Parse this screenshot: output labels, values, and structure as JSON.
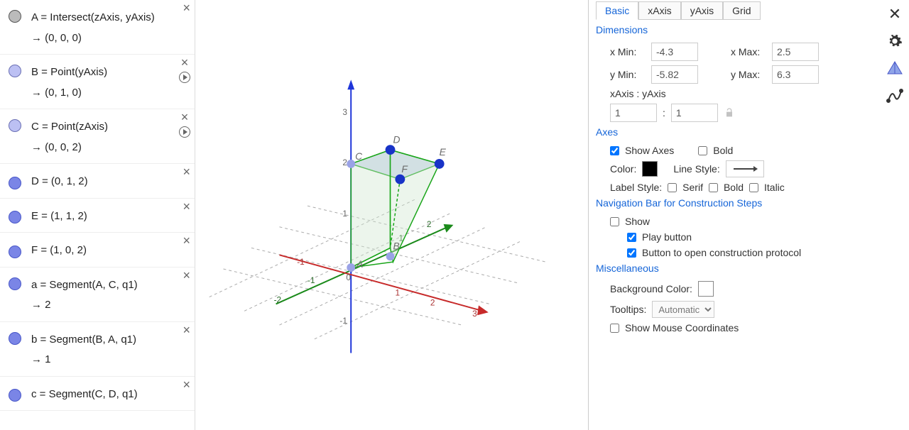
{
  "algebra": {
    "rows": [
      {
        "line1": "A = Intersect(zAxis, yAxis)",
        "line2": "→   (0, 0, 0)",
        "bullet": "gray",
        "close": true,
        "play": false
      },
      {
        "line1": "B = Point(yAxis)",
        "line2": "→   (0, 1, 0)",
        "bullet": "lav",
        "close": true,
        "play": true
      },
      {
        "line1": "C = Point(zAxis)",
        "line2": "→   (0, 0, 2)",
        "bullet": "lav",
        "close": true,
        "play": true
      },
      {
        "line1": "D = (0, 1, 2)",
        "line2": "",
        "bullet": "blue",
        "close": true,
        "play": false
      },
      {
        "line1": "E = (1, 1, 2)",
        "line2": "",
        "bullet": "blue",
        "close": true,
        "play": false
      },
      {
        "line1": "F = (1, 0, 2)",
        "line2": "",
        "bullet": "blue",
        "close": true,
        "play": false
      },
      {
        "line1": "a = Segment(A, C, q1)",
        "line2": "→   2",
        "bullet": "blue",
        "close": true,
        "play": false
      },
      {
        "line1": "b = Segment(B, A, q1)",
        "line2": "→   1",
        "bullet": "blue",
        "close": true,
        "play": false
      },
      {
        "line1": "c = Segment(C, D, q1)",
        "line2": "",
        "bullet": "blue",
        "close": true,
        "play": false
      }
    ]
  },
  "viewport": {
    "zTicks": [
      "3",
      "2",
      "1",
      "-1"
    ],
    "yTicks": [
      "-2",
      "-1",
      "1",
      "2"
    ],
    "xTicks": [
      "-1",
      "1",
      "2",
      "3"
    ],
    "origin": "0",
    "ptLabels": {
      "A": "A",
      "B": "B",
      "C": "C",
      "D": "D",
      "E": "E",
      "F": "F"
    }
  },
  "tabs": {
    "basic": "Basic",
    "x": "xAxis",
    "y": "yAxis",
    "grid": "Grid"
  },
  "dims": {
    "header": "Dimensions",
    "xmin_l": "x Min:",
    "xmin": "-4.3",
    "xmax_l": "x Max:",
    "xmax": "2.5",
    "ymin_l": "y Min:",
    "ymin": "-5.82",
    "ymax_l": "y Max:",
    "ymax": "6.3",
    "ratio_l": "xAxis : yAxis",
    "rx": "1",
    "ry": "1"
  },
  "axes": {
    "header": "Axes",
    "show": "Show Axes",
    "bold": "Bold",
    "color_l": "Color:",
    "ls_l": "Line Style:",
    "labelstyle_l": "Label Style:",
    "serif": "Serif",
    "bold2": "Bold",
    "italic": "Italic"
  },
  "nav": {
    "header": "Navigation Bar for Construction Steps",
    "show": "Show",
    "play": "Play button",
    "btn": "Button to open construction protocol"
  },
  "misc": {
    "header": "Miscellaneous",
    "bg_l": "Background Color:",
    "tt_l": "Tooltips:",
    "tt_val": "Automatic",
    "mouse": "Show Mouse Coordinates"
  },
  "ratio_colon": ":"
}
